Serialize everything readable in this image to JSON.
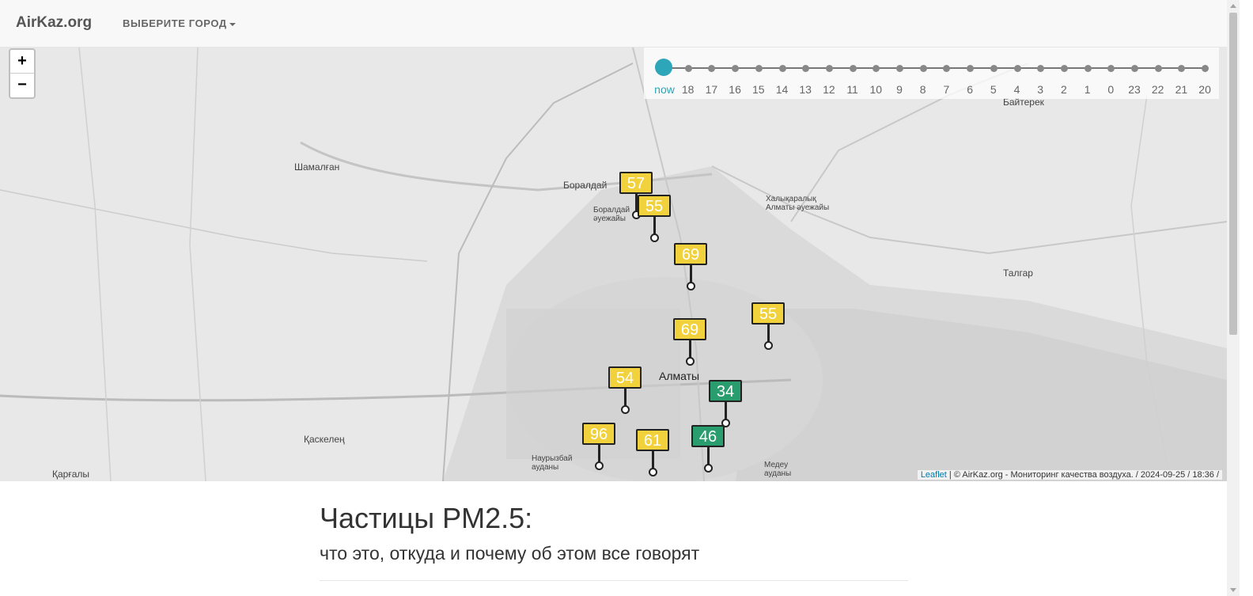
{
  "navbar": {
    "brand": "AirKaz.org",
    "city_dropdown": "ВЫБЕРИТЕ ГОРОД"
  },
  "zoom": {
    "in": "+",
    "out": "−"
  },
  "timeline": {
    "labels": [
      "now",
      "18",
      "17",
      "16",
      "15",
      "14",
      "13",
      "12",
      "11",
      "10",
      "9",
      "8",
      "7",
      "6",
      "5",
      "4",
      "3",
      "2",
      "1",
      "0",
      "23",
      "22",
      "21",
      "20"
    ],
    "selected": "now"
  },
  "map_labels": {
    "almaty": "Алматы",
    "boraldai": "Боралдай",
    "shamalgan": "Шамалған",
    "talgar": "Талгар",
    "kaskelen": "Қаскелең",
    "bayterek": "Байтерек",
    "kargaly": "Қарғалы",
    "airport": "Халықаралық Алматы әуежайы",
    "boraldai_airport": "Боралдай әуежайы",
    "nauryzbai": "Наурызбай ауданы",
    "medeu": "Медеу ауданы"
  },
  "markers": [
    {
      "value": "57",
      "color": "#f2d23c"
    },
    {
      "value": "55",
      "color": "#f2d23c"
    },
    {
      "value": "69",
      "color": "#f2d23c"
    },
    {
      "value": "69",
      "color": "#f2d23c"
    },
    {
      "value": "55",
      "color": "#f2d23c"
    },
    {
      "value": "54",
      "color": "#f2d23c"
    },
    {
      "value": "34",
      "color": "#2a9d6e"
    },
    {
      "value": "96",
      "color": "#f2d23c"
    },
    {
      "value": "61",
      "color": "#f2d23c"
    },
    {
      "value": "46",
      "color": "#2a9d6e"
    }
  ],
  "attribution": {
    "leaflet": "Leaflet",
    "text": " | © AirKaz.org - Мониторинг качества воздуха. / 2024-09-25 / 18:36 /"
  },
  "article": {
    "title": "Частицы PM2.5:",
    "subtitle": "что это, откуда и почему об этом все говорят"
  }
}
